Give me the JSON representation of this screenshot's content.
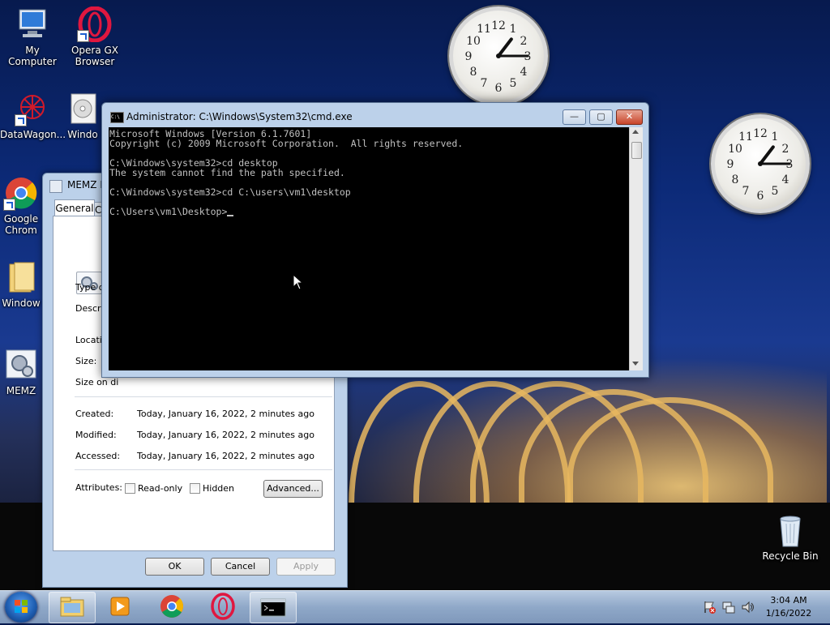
{
  "desktop": {
    "icons": [
      {
        "label": "My Computer"
      },
      {
        "label": "Opera GX Browser"
      },
      {
        "label": "DataWagon..."
      },
      {
        "label": "Windo"
      },
      {
        "label": "Google Chrom"
      },
      {
        "label": "Window"
      },
      {
        "label": "MEMZ"
      },
      {
        "label": "Recycle Bin"
      }
    ]
  },
  "clocks": [
    {
      "hour": 1,
      "minute": 15
    },
    {
      "hour": 1,
      "minute": 15
    }
  ],
  "props": {
    "title": "MEMZ P",
    "tabs": [
      "General",
      "C"
    ],
    "labels": {
      "type": "Type of fi",
      "description": "Descriptio",
      "location": "Location:",
      "size": "Size:",
      "size_on_disk": "Size on di",
      "created": "Created:",
      "modified": "Modified:",
      "accessed": "Accessed:",
      "attributes": "Attributes:"
    },
    "values": {
      "created": "Today, January 16, 2022, 2 minutes ago",
      "modified": "Today, January 16, 2022, 2 minutes ago",
      "accessed": "Today, January 16, 2022, 2 minutes ago"
    },
    "checkboxes": {
      "readonly": "Read-only",
      "hidden": "Hidden"
    },
    "buttons": {
      "advanced": "Advanced...",
      "ok": "OK",
      "cancel": "Cancel",
      "apply": "Apply"
    }
  },
  "cmd": {
    "title": "Administrator: C:\\Windows\\System32\\cmd.exe",
    "icon_text": "C:\\",
    "controls": {
      "minimize": "—",
      "maximize": "▢",
      "close": "✕"
    },
    "lines": [
      "Microsoft Windows [Version 6.1.7601]",
      "Copyright (c) 2009 Microsoft Corporation.  All rights reserved.",
      "",
      "C:\\Windows\\system32>cd desktop",
      "The system cannot find the path specified.",
      "",
      "C:\\Windows\\system32>cd C:\\users\\vm1\\desktop",
      "",
      "C:\\Users\\vm1\\Desktop>"
    ]
  },
  "taskbar": {
    "items": [
      "Windows Explorer",
      "Windows Media Player",
      "Google Chrome",
      "Opera GX",
      "Command Prompt"
    ],
    "time": "3:04 AM",
    "date": "1/16/2022"
  }
}
